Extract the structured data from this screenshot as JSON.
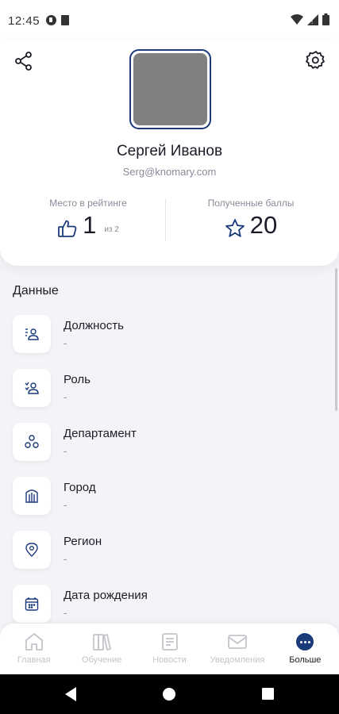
{
  "status_bar": {
    "time": "12:45"
  },
  "header": {
    "share_icon": "share-icon",
    "settings_icon": "gear-icon",
    "user_name": "Сергей Иванов",
    "user_email": "Serg@knomary.com"
  },
  "stats": {
    "rank_label": "Место в рейтинге",
    "rank_value": "1",
    "rank_of": "из 2",
    "points_label": "Полученные баллы",
    "points_value": "20"
  },
  "data_section": {
    "title": "Данные",
    "items": [
      {
        "label": "Должность",
        "value": "-",
        "icon": "position-icon"
      },
      {
        "label": "Роль",
        "value": "-",
        "icon": "role-icon"
      },
      {
        "label": "Департамент",
        "value": "-",
        "icon": "department-icon"
      },
      {
        "label": "Город",
        "value": "-",
        "icon": "city-icon"
      },
      {
        "label": "Регион",
        "value": "-",
        "icon": "location-pin-icon"
      },
      {
        "label": "Дата рождения",
        "value": "-",
        "icon": "calendar-icon"
      }
    ]
  },
  "bottom_nav": {
    "items": [
      {
        "label": "Главная",
        "icon": "home-icon",
        "active": false
      },
      {
        "label": "Обучение",
        "icon": "books-icon",
        "active": false
      },
      {
        "label": "Новости",
        "icon": "news-icon",
        "active": false
      },
      {
        "label": "Уведомления",
        "icon": "mail-icon",
        "active": false
      },
      {
        "label": "Больше",
        "icon": "more-icon",
        "active": true
      }
    ]
  },
  "colors": {
    "accent": "#1a3a7a",
    "muted_text": "#8a8a99",
    "background": "#f4f4f8"
  }
}
